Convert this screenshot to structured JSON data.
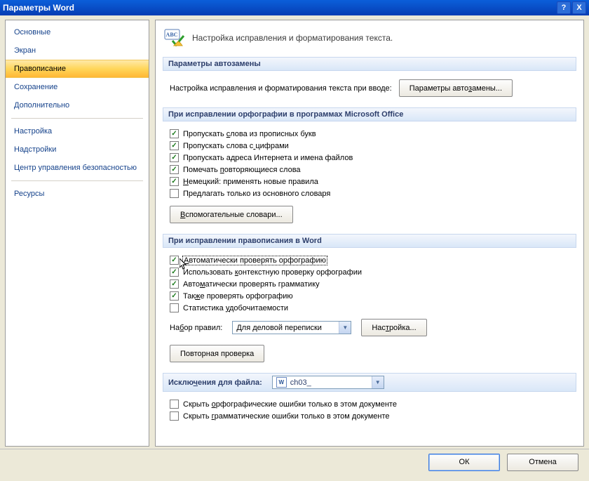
{
  "window": {
    "title": "Параметры Word"
  },
  "titlebar_buttons": {
    "help": "?",
    "close": "X"
  },
  "sidebar": {
    "items": [
      {
        "label": "Основные"
      },
      {
        "label": "Экран"
      },
      {
        "label": "Правописание"
      },
      {
        "label": "Сохранение"
      },
      {
        "label": "Дополнительно"
      },
      {
        "label": "Настройка"
      },
      {
        "label": "Надстройки"
      },
      {
        "label": "Центр управления безопасностью"
      },
      {
        "label": "Ресурсы"
      }
    ],
    "active_index": 2,
    "separators_after": [
      4,
      7
    ]
  },
  "header": {
    "icon": "abc-check-icon",
    "text": "Настройка исправления и форматирования текста."
  },
  "section_autocorrect": {
    "title": "Параметры автозамены",
    "text": "Настройка исправления и форматирования текста при вводе:",
    "button": "Параметры автозамены..."
  },
  "section_office": {
    "title": "При исправлении орфографии в программах Microsoft Office",
    "checks": [
      {
        "checked": true,
        "label": "Пропускать слова из прописных букв",
        "u": 11
      },
      {
        "checked": true,
        "label": "Пропускать слова с цифрами",
        "u": 18
      },
      {
        "checked": true,
        "label": "Пропускать адреса Интернета и имена файлов",
        "u": null
      },
      {
        "checked": true,
        "label": "Помечать повторяющиеся слова",
        "u": 9
      },
      {
        "checked": true,
        "label": "Немецкий: применять новые правила",
        "u": 0
      },
      {
        "checked": false,
        "label": "Предлагать только из основного словаря",
        "u": null
      }
    ],
    "aux_button": "Вспомогательные словари...",
    "aux_u": 0
  },
  "section_word": {
    "title": "При исправлении правописания в Word",
    "checks": [
      {
        "checked": true,
        "label": "Автоматически проверять орфографию",
        "u": 0,
        "box": true
      },
      {
        "checked": true,
        "label": "Использовать контекстную проверку орфографии",
        "u": 13
      },
      {
        "checked": true,
        "label": "Автоматически проверять грамматику",
        "u": 4
      },
      {
        "checked": true,
        "label": "Также проверять орфографию",
        "u": 3
      },
      {
        "checked": false,
        "label": "Статистика удобочитаемости",
        "u": 11
      }
    ],
    "ruleset_label": "Набор правил:",
    "ruleset_u": 2,
    "ruleset_value": "Для деловой переписки",
    "ruleset_button": "Настройка...",
    "ruleset_button_u": 3,
    "recheck_button": "Повторная проверка"
  },
  "section_exceptions": {
    "title": "Исключения для файла:",
    "title_u": 5,
    "file_icon": "W",
    "file_value": "ch03_",
    "checks": [
      {
        "checked": false,
        "label": "Скрыть орфографические ошибки только в этом документе",
        "u": 7
      },
      {
        "checked": false,
        "label": "Скрыть грамматические ошибки только в этом документе",
        "u": 7
      }
    ]
  },
  "buttons": {
    "ok": "ОК",
    "cancel": "Отмена"
  }
}
